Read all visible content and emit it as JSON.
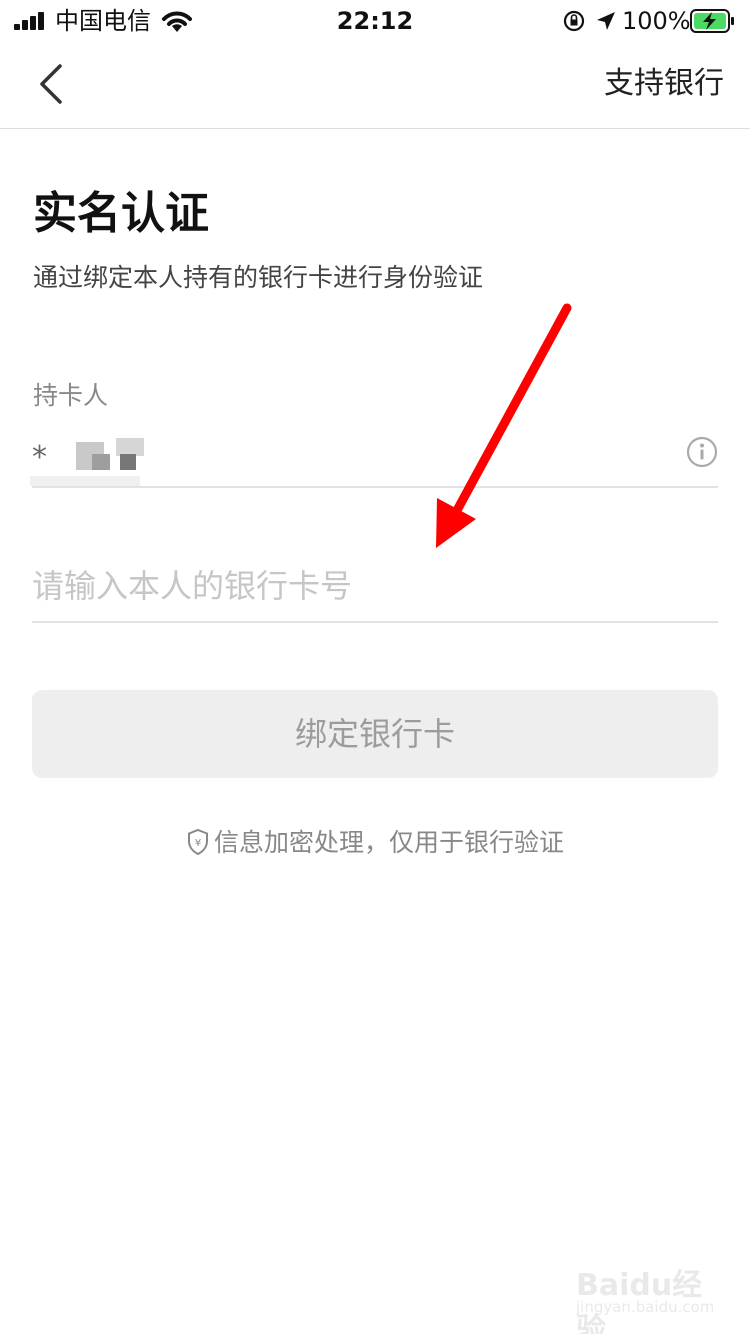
{
  "status_bar": {
    "carrier": "中国电信",
    "time": "22:12",
    "battery_percent": "100%",
    "icons": [
      "signal-icon",
      "wifi-icon",
      "rotation-lock-icon",
      "location-icon",
      "battery-charging-icon"
    ]
  },
  "nav": {
    "back_icon": "chevron-left-icon",
    "support_bank_label": "支持银行"
  },
  "page": {
    "title": "实名认证",
    "subtitle": "通过绑定本人持有的银行卡进行身份验证"
  },
  "form": {
    "holder_label": "持卡人",
    "holder_name_masked": "*",
    "info_icon": "info-icon",
    "card_number_placeholder": "请输入本人的银行卡号",
    "card_number_value": ""
  },
  "bind_button_label": "绑定银行卡",
  "notice": {
    "icon": "shield-yuan-icon",
    "text": "信息加密处理，仅用于银行验证"
  },
  "watermark": {
    "brand": "Baidu经验",
    "url": "jingyan.baidu.com"
  },
  "colors": {
    "annotation_arrow": "#ff0000",
    "button_bg": "#eeeeee",
    "button_text": "#9c9c9c",
    "placeholder": "#c6c6c6",
    "battery_fill": "#4cd964"
  }
}
